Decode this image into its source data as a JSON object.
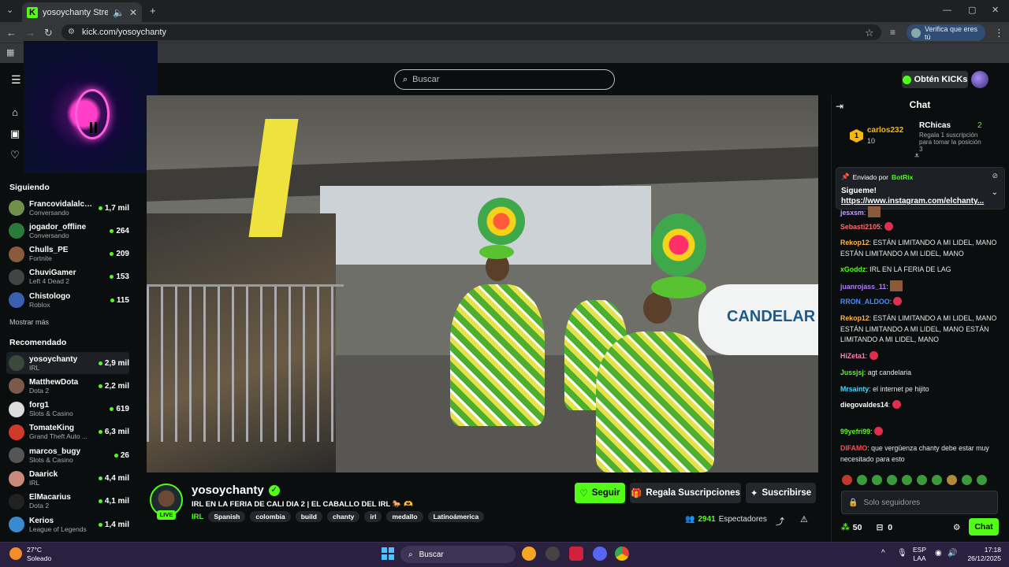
{
  "browser": {
    "tab_title": "yosoychanty Stream - Wat",
    "url": "kick.com/yosoychanty",
    "verify_label": "Verifica que eres tú"
  },
  "header": {
    "search_placeholder": "Buscar",
    "get_kicks": "Obtén KICKs"
  },
  "sidebar": {
    "following_title": "Siguiendo",
    "following": [
      {
        "name": "Francovidalalcal...",
        "category": "Conversando",
        "viewers": "1,7 mil",
        "color": "#6f8f4a"
      },
      {
        "name": "jogador_offline",
        "category": "Conversando",
        "viewers": "264",
        "color": "#2a7a3b"
      },
      {
        "name": "Chulls_PE",
        "category": "Fortnite",
        "viewers": "209",
        "color": "#8a5a3c"
      },
      {
        "name": "ChuviGamer",
        "category": "Left 4 Dead 2",
        "viewers": "153",
        "color": "#444"
      },
      {
        "name": "Chistologo",
        "category": "Roblox",
        "viewers": "115",
        "color": "#3b5fb0"
      }
    ],
    "show_more": "Mostrar más",
    "recommended_title": "Recomendado",
    "recommended": [
      {
        "name": "yosoychanty",
        "category": "IRL",
        "viewers": "2,9 mil",
        "color": "#3a4a3a"
      },
      {
        "name": "MatthewDota",
        "category": "Dota 2",
        "viewers": "2,2 mil",
        "color": "#7a5a4a"
      },
      {
        "name": "forg1",
        "category": "Slots & Casino",
        "viewers": "619",
        "color": "#ddd"
      },
      {
        "name": "TomateKing",
        "category": "Grand Theft Auto ...",
        "viewers": "6,3 mil",
        "color": "#d03a2a"
      },
      {
        "name": "marcos_bugy",
        "category": "Slots & Casino",
        "viewers": "26",
        "color": "#555"
      },
      {
        "name": "Daarick",
        "category": "IRL",
        "viewers": "4,4 mil",
        "color": "#c98a7a"
      },
      {
        "name": "ElMacarius",
        "category": "Dota 2",
        "viewers": "4,1 mil",
        "color": "#222"
      },
      {
        "name": "Kerios",
        "category": "League of Legends",
        "viewers": "1,4 mil",
        "color": "#3a8ad0"
      }
    ]
  },
  "video": {
    "banner_text": "CANDELAR"
  },
  "stream": {
    "streamer": "yosoychanty",
    "live": "LIVE",
    "title": "IRL EN LA FERIA DE CALI DIA 2 | EL CABALLO DEL IRL 🐎 🫶",
    "category": "IRL",
    "tags": [
      "Spanish",
      "colombia",
      "build",
      "chanty",
      "irl",
      "medallo",
      "Latinoámerica"
    ],
    "follow": "Seguir",
    "gift_subs": "Regala Suscripciones",
    "subscribe": "Suscribirse",
    "viewers_count": "2941",
    "viewers_label": "Espectadores"
  },
  "chat": {
    "title": "Chat",
    "leader_name": "carlos232",
    "leader_points": "10",
    "gift_name": "RChicas",
    "gift_count": "2",
    "gift_text": "Regala 1 suscripción para tomar la posición 3",
    "pinned_by_label": "Enviado por",
    "pinned_by": "BotRix",
    "pinned_text": "Sigueme!",
    "pinned_link": "https://www.instagram.com/elchanty...",
    "messages": [
      {
        "user": "jesxsm",
        "text": "",
        "color": "#c7a0ff"
      },
      {
        "user": "Sebasti2105",
        "text": "",
        "color": "#ff6b6b"
      },
      {
        "user": "Rekop12",
        "text": "ESTÁN LIMITANDO A MI LIDEL, MANO ESTÁN LIMITANDO A MI LIDEL, MANO",
        "color": "#ffb24a"
      },
      {
        "user": "xGoddz",
        "text": "IRL EN LA FERIA DE LAG",
        "color": "#53fc18"
      },
      {
        "user": "juanrojass_11",
        "text": "",
        "color": "#b07cff"
      },
      {
        "user": "RRON_ALDOO",
        "text": "",
        "color": "#4a8cff"
      },
      {
        "user": "Rekop12",
        "text": "ESTÁN LIMITANDO A MI LIDEL, MANO ESTÁN LIMITANDO A MI LIDEL, MANO ESTÁN LIMITANDO A MI LIDEL, MANO",
        "color": "#ffb24a"
      },
      {
        "user": "HiZeta1",
        "text": "",
        "color": "#ff7eb6"
      },
      {
        "user": "Jussjsj",
        "text": "agt candelaria",
        "color": "#53fc18"
      },
      {
        "user": "Mrsainty",
        "text": "el internet pe hijito",
        "color": "#4ad6ff"
      },
      {
        "user": "diegovaldes14",
        "text": "",
        "color": "#ffffff"
      },
      {
        "user": "99yefri99",
        "text": "",
        "color": "#53fc18"
      },
      {
        "user": "DIFAMO",
        "text": "que vergüenza chanty debe estar muy necesitado para esto",
        "color": "#ff4d4d"
      }
    ],
    "input_placeholder": "Solo seguidores",
    "points": "50",
    "drops": "0",
    "send": "Chat"
  },
  "taskbar": {
    "temp": "27°C",
    "weather": "Soleado",
    "search": "Buscar",
    "lang1": "ESP",
    "lang2": "LAA",
    "time": "17:18",
    "date": "26/12/2025"
  }
}
